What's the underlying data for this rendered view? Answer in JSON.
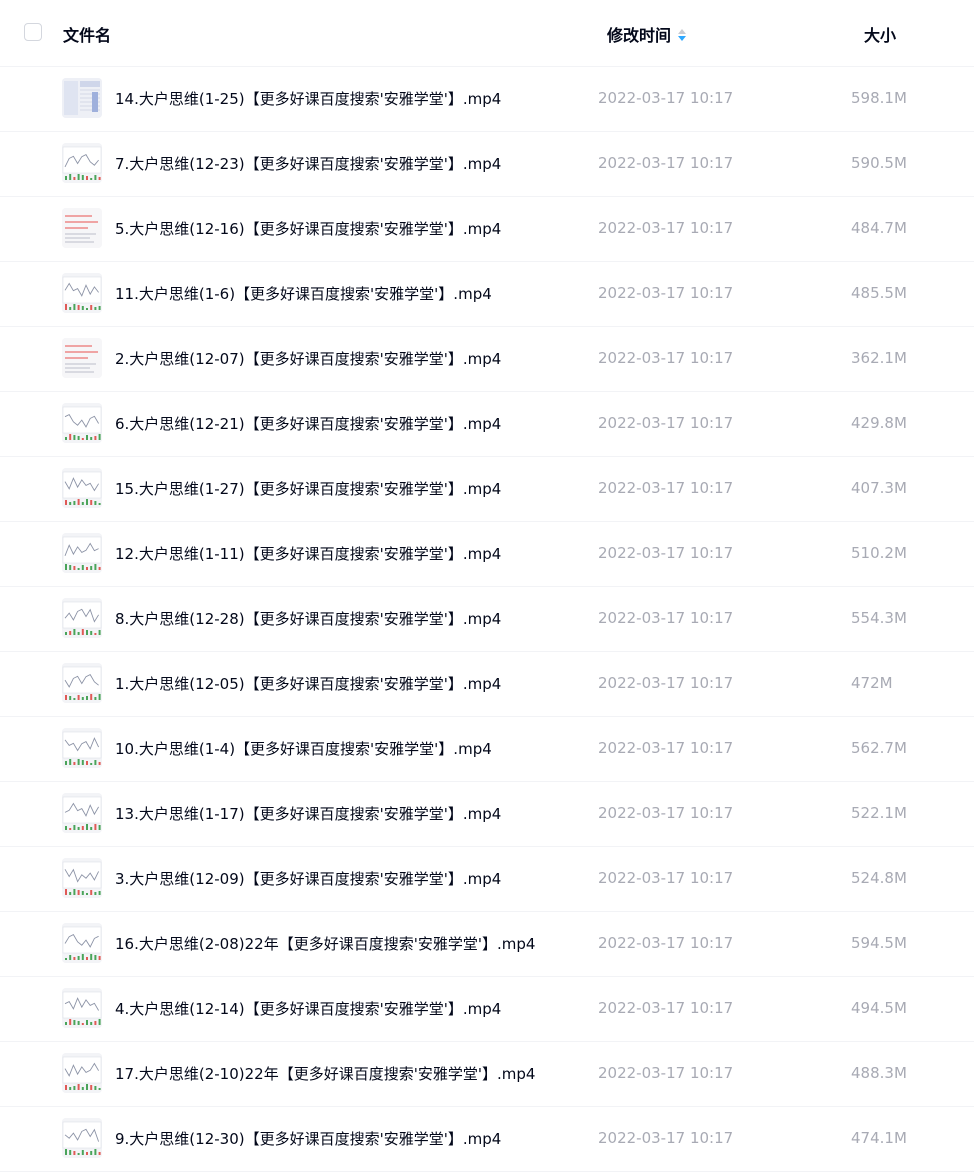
{
  "header": {
    "name_label": "文件名",
    "time_label": "修改时间",
    "size_label": "大小",
    "sort_icon": "sort-icon",
    "sort_color": "#2ea8ff"
  },
  "files": [
    {
      "name": "14.大户思维(1-25)【更多好课百度搜索'安雅学堂'】.mp4",
      "time": "2022-03-17 10:17",
      "size": "598.1M",
      "thumb": "table"
    },
    {
      "name": "7.大户思维(12-23)【更多好课百度搜索'安雅学堂'】.mp4",
      "time": "2022-03-17 10:17",
      "size": "590.5M",
      "thumb": "chart"
    },
    {
      "name": "5.大户思维(12-16)【更多好课百度搜索'安雅学堂'】.mp4",
      "time": "2022-03-17 10:17",
      "size": "484.7M",
      "thumb": "text-red"
    },
    {
      "name": "11.大户思维(1-6)【更多好课百度搜索'安雅学堂'】.mp4",
      "time": "2022-03-17 10:17",
      "size": "485.5M",
      "thumb": "chart"
    },
    {
      "name": "2.大户思维(12-07)【更多好课百度搜索'安雅学堂'】.mp4",
      "time": "2022-03-17 10:17",
      "size": "362.1M",
      "thumb": "text-red"
    },
    {
      "name": "6.大户思维(12-21)【更多好课百度搜索'安雅学堂'】.mp4",
      "time": "2022-03-17 10:17",
      "size": "429.8M",
      "thumb": "chart"
    },
    {
      "name": "15.大户思维(1-27)【更多好课百度搜索'安雅学堂'】.mp4",
      "time": "2022-03-17 10:17",
      "size": "407.3M",
      "thumb": "chart"
    },
    {
      "name": "12.大户思维(1-11)【更多好课百度搜索'安雅学堂'】.mp4",
      "time": "2022-03-17 10:17",
      "size": "510.2M",
      "thumb": "chart"
    },
    {
      "name": "8.大户思维(12-28)【更多好课百度搜索'安雅学堂'】.mp4",
      "time": "2022-03-17 10:17",
      "size": "554.3M",
      "thumb": "chart"
    },
    {
      "name": "1.大户思维(12-05)【更多好课百度搜索'安雅学堂'】.mp4",
      "time": "2022-03-17 10:17",
      "size": "472M",
      "thumb": "chart"
    },
    {
      "name": "10.大户思维(1-4)【更多好课百度搜索'安雅学堂'】.mp4",
      "time": "2022-03-17 10:17",
      "size": "562.7M",
      "thumb": "chart"
    },
    {
      "name": "13.大户思维(1-17)【更多好课百度搜索'安雅学堂'】.mp4",
      "time": "2022-03-17 10:17",
      "size": "522.1M",
      "thumb": "chart"
    },
    {
      "name": "3.大户思维(12-09)【更多好课百度搜索'安雅学堂'】.mp4",
      "time": "2022-03-17 10:17",
      "size": "524.8M",
      "thumb": "chart"
    },
    {
      "name": "16.大户思维(2-08)22年【更多好课百度搜索'安雅学堂'】.mp4",
      "time": "2022-03-17 10:17",
      "size": "594.5M",
      "thumb": "chart"
    },
    {
      "name": "4.大户思维(12-14)【更多好课百度搜索'安雅学堂'】.mp4",
      "time": "2022-03-17 10:17",
      "size": "494.5M",
      "thumb": "chart"
    },
    {
      "name": "17.大户思维(2-10)22年【更多好课百度搜索'安雅学堂'】.mp4",
      "time": "2022-03-17 10:17",
      "size": "488.3M",
      "thumb": "chart"
    },
    {
      "name": "9.大户思维(12-30)【更多好课百度搜索'安雅学堂'】.mp4",
      "time": "2022-03-17 10:17",
      "size": "474.1M",
      "thumb": "chart"
    }
  ]
}
